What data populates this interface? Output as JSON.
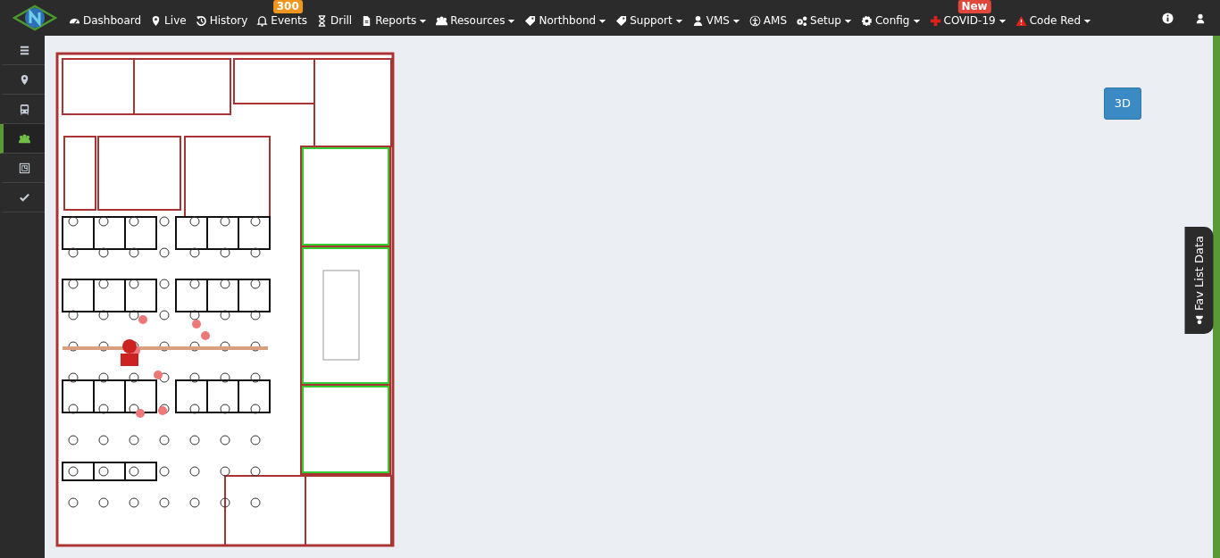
{
  "navbar": {
    "items": [
      {
        "label": "Dashboard",
        "dropdown": false
      },
      {
        "label": "Live",
        "dropdown": false
      },
      {
        "label": "History",
        "dropdown": false
      },
      {
        "label": "Events",
        "dropdown": false,
        "badge": "300",
        "color": "#f0961e"
      },
      {
        "label": "Drill",
        "dropdown": false
      },
      {
        "label": "Reports",
        "dropdown": true
      },
      {
        "label": "Resources",
        "dropdown": true
      },
      {
        "label": "Northbond",
        "dropdown": true
      },
      {
        "label": "Support",
        "dropdown": true
      },
      {
        "label": "VMS",
        "dropdown": true
      },
      {
        "label": "AMS",
        "dropdown": false
      },
      {
        "label": "Setup",
        "dropdown": true
      },
      {
        "label": "Config",
        "dropdown": true
      },
      {
        "label": "COVID-19",
        "dropdown": true,
        "badge": "New",
        "color": "#e0483c"
      },
      {
        "label": "Code Red",
        "dropdown": true
      }
    ]
  },
  "sidebar": {
    "items": [
      {
        "selected": false
      },
      {
        "selected": false
      },
      {
        "selected": false
      },
      {
        "selected": true
      },
      {
        "selected": false
      },
      {
        "selected": false
      }
    ]
  },
  "view_button": "3D",
  "fav_tab": "Fav List Data"
}
